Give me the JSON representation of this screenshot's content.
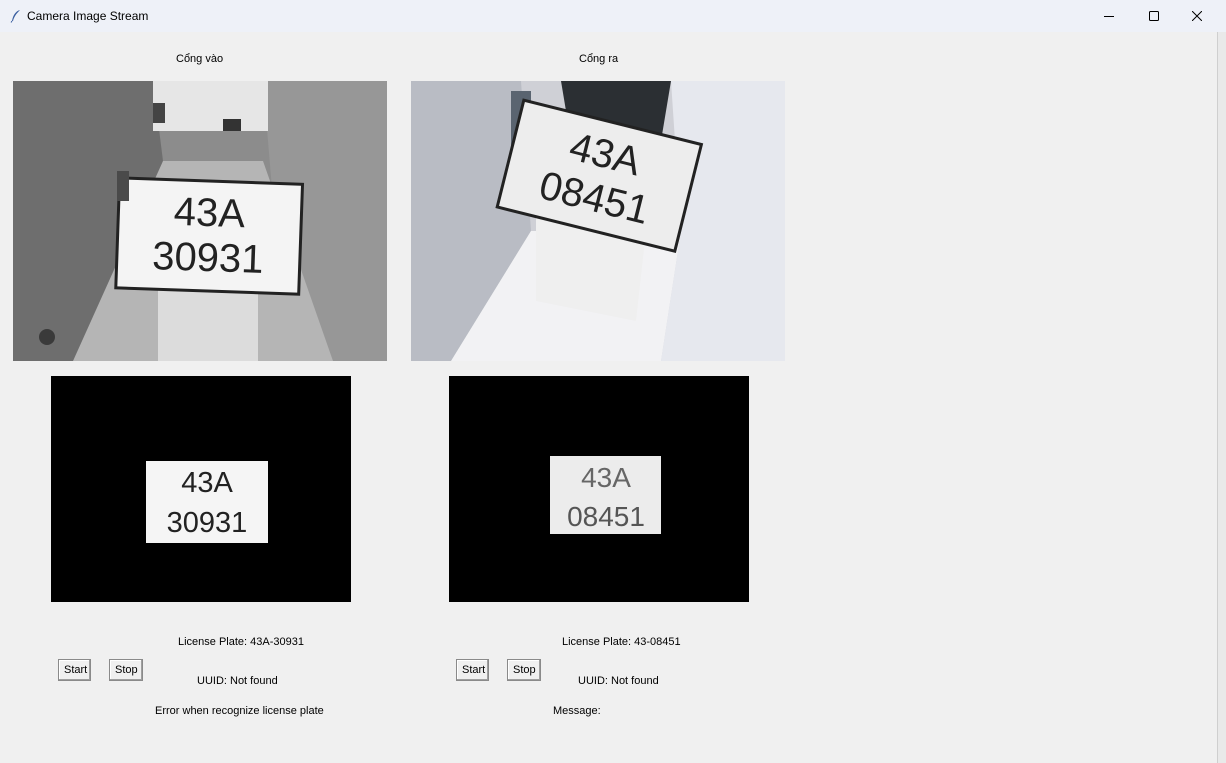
{
  "window": {
    "title": "Camera Image Stream",
    "minimize": "–",
    "maximize": "□",
    "close": "✕"
  },
  "entry": {
    "title": "Cổng vào",
    "plate_line1": "43A",
    "plate_line2": "30931",
    "license_plate": "License Plate: 43A-30931",
    "uuid": "UUID: Not found",
    "message": "Error when recognize license plate",
    "start_label": "Start",
    "stop_label": "Stop"
  },
  "exit": {
    "title": "Cổng ra",
    "plate_line1": "43A",
    "plate_line2": "08451",
    "license_plate": "License Plate: 43-08451",
    "uuid": "UUID: Not found",
    "message": "Message:",
    "start_label": "Start",
    "stop_label": "Stop"
  }
}
